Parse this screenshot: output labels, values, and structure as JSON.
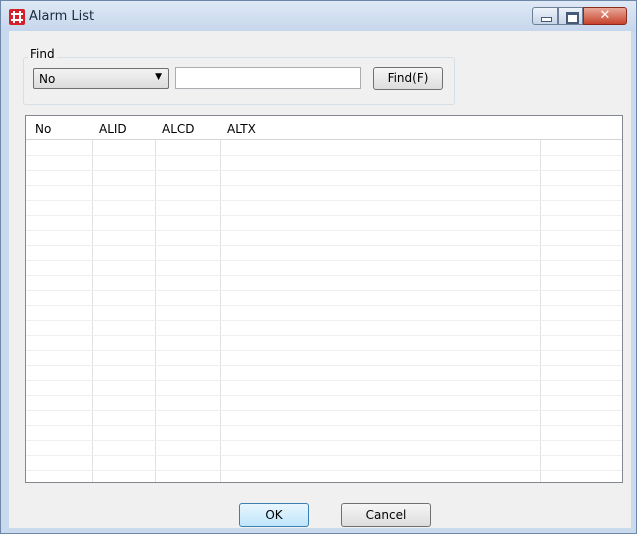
{
  "window": {
    "title": "Alarm List",
    "icon": "app-icon"
  },
  "find": {
    "group_label": "Find",
    "field_selected": "No",
    "search_value": "",
    "button_label": "Find(F)"
  },
  "table": {
    "columns": [
      "No",
      "ALID",
      "ALCD",
      "ALTX",
      ""
    ],
    "rows": []
  },
  "dialog_buttons": {
    "ok": "OK",
    "cancel": "Cancel"
  },
  "colors": {
    "title_bar": "#c6d6ec",
    "close_button": "#c7432b",
    "ok_button": "#bee6fd"
  }
}
